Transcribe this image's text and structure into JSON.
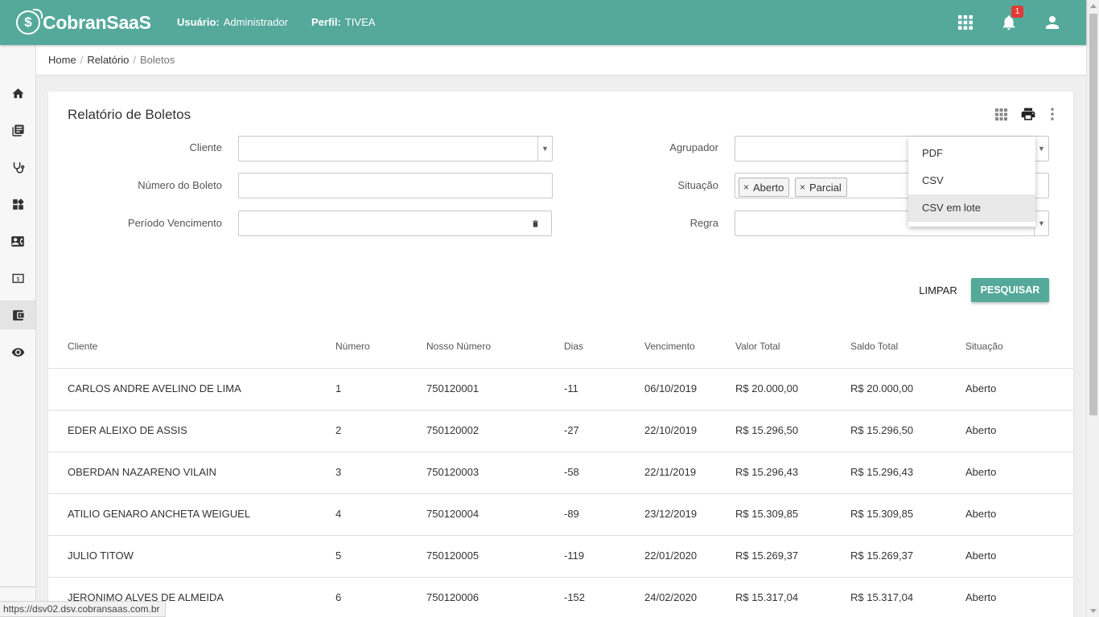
{
  "header": {
    "logo_text": "CobranSaaS",
    "logo_mark": "$",
    "user_label": "Usuário:",
    "user_value": "Administrador",
    "profile_label": "Perfil:",
    "profile_value": "TIVEA",
    "notification_count": "1",
    "icons": [
      "apps-grid-icon",
      "bell-icon",
      "account-icon"
    ],
    "color": "#55a99b"
  },
  "sidebar": {
    "items": [
      {
        "icon": "home-icon"
      },
      {
        "icon": "book-icon"
      },
      {
        "icon": "stethoscope-icon"
      },
      {
        "icon": "widgets-icon"
      },
      {
        "icon": "contact-card-icon"
      },
      {
        "icon": "money-icon"
      },
      {
        "icon": "wallet-icon",
        "active": true
      },
      {
        "icon": "eye-icon"
      }
    ]
  },
  "breadcrumb": {
    "home": "Home",
    "relatorio": "Relatório",
    "current": "Boletos",
    "separator": "/"
  },
  "card": {
    "title": "Relatório de Boletos",
    "tools": [
      "grid-icon",
      "print-icon",
      "more-vert-icon"
    ]
  },
  "filters": {
    "cliente_label": "Cliente",
    "cliente_value": "",
    "numero_label": "Número do Boleto",
    "numero_value": "",
    "periodo_label": "Período Vencimento",
    "periodo_value": "",
    "agrupador_label": "Agrupador",
    "agrupador_value": "",
    "situacao_label": "Situação",
    "situacao_chips": [
      "Aberto",
      "Parcial"
    ],
    "regra_label": "Regra",
    "regra_value": "",
    "chip_remove": "×",
    "caret": "▼"
  },
  "actions": {
    "clear": "LIMPAR",
    "search": "PESQUISAR"
  },
  "export_menu": {
    "items": [
      "PDF",
      "CSV",
      "CSV em lote"
    ],
    "hovered": "CSV em lote"
  },
  "table": {
    "columns": [
      "Cliente",
      "Número",
      "Nosso Número",
      "Dias",
      "Vencimento",
      "Valor Total",
      "Saldo Total",
      "Situação"
    ],
    "rows": [
      [
        "CARLOS ANDRE AVELINO DE LIMA",
        "1",
        "750120001",
        "-11",
        "06/10/2019",
        "R$ 20.000,00",
        "R$ 20.000,00",
        "Aberto"
      ],
      [
        "EDER ALEIXO DE ASSIS",
        "2",
        "750120002",
        "-27",
        "22/10/2019",
        "R$ 15.296,50",
        "R$ 15.296,50",
        "Aberto"
      ],
      [
        "OBERDAN NAZARENO VILAIN",
        "3",
        "750120003",
        "-58",
        "22/11/2019",
        "R$ 15.296,43",
        "R$ 15.296,43",
        "Aberto"
      ],
      [
        "ATILIO GENARO ANCHETA WEIGUEL",
        "4",
        "750120004",
        "-89",
        "23/12/2019",
        "R$ 15.309,85",
        "R$ 15.309,85",
        "Aberto"
      ],
      [
        "JULIO TITOW",
        "5",
        "750120005",
        "-119",
        "22/01/2020",
        "R$ 15.269,37",
        "R$ 15.269,37",
        "Aberto"
      ],
      [
        "JERONIMO ALVES DE ALMEIDA",
        "6",
        "750120006",
        "-152",
        "24/02/2020",
        "R$ 15.317,04",
        "R$ 15.317,04",
        "Aberto"
      ]
    ]
  },
  "status_bar": {
    "url": "https://dsv02.dsv.cobransaas.com.br"
  }
}
